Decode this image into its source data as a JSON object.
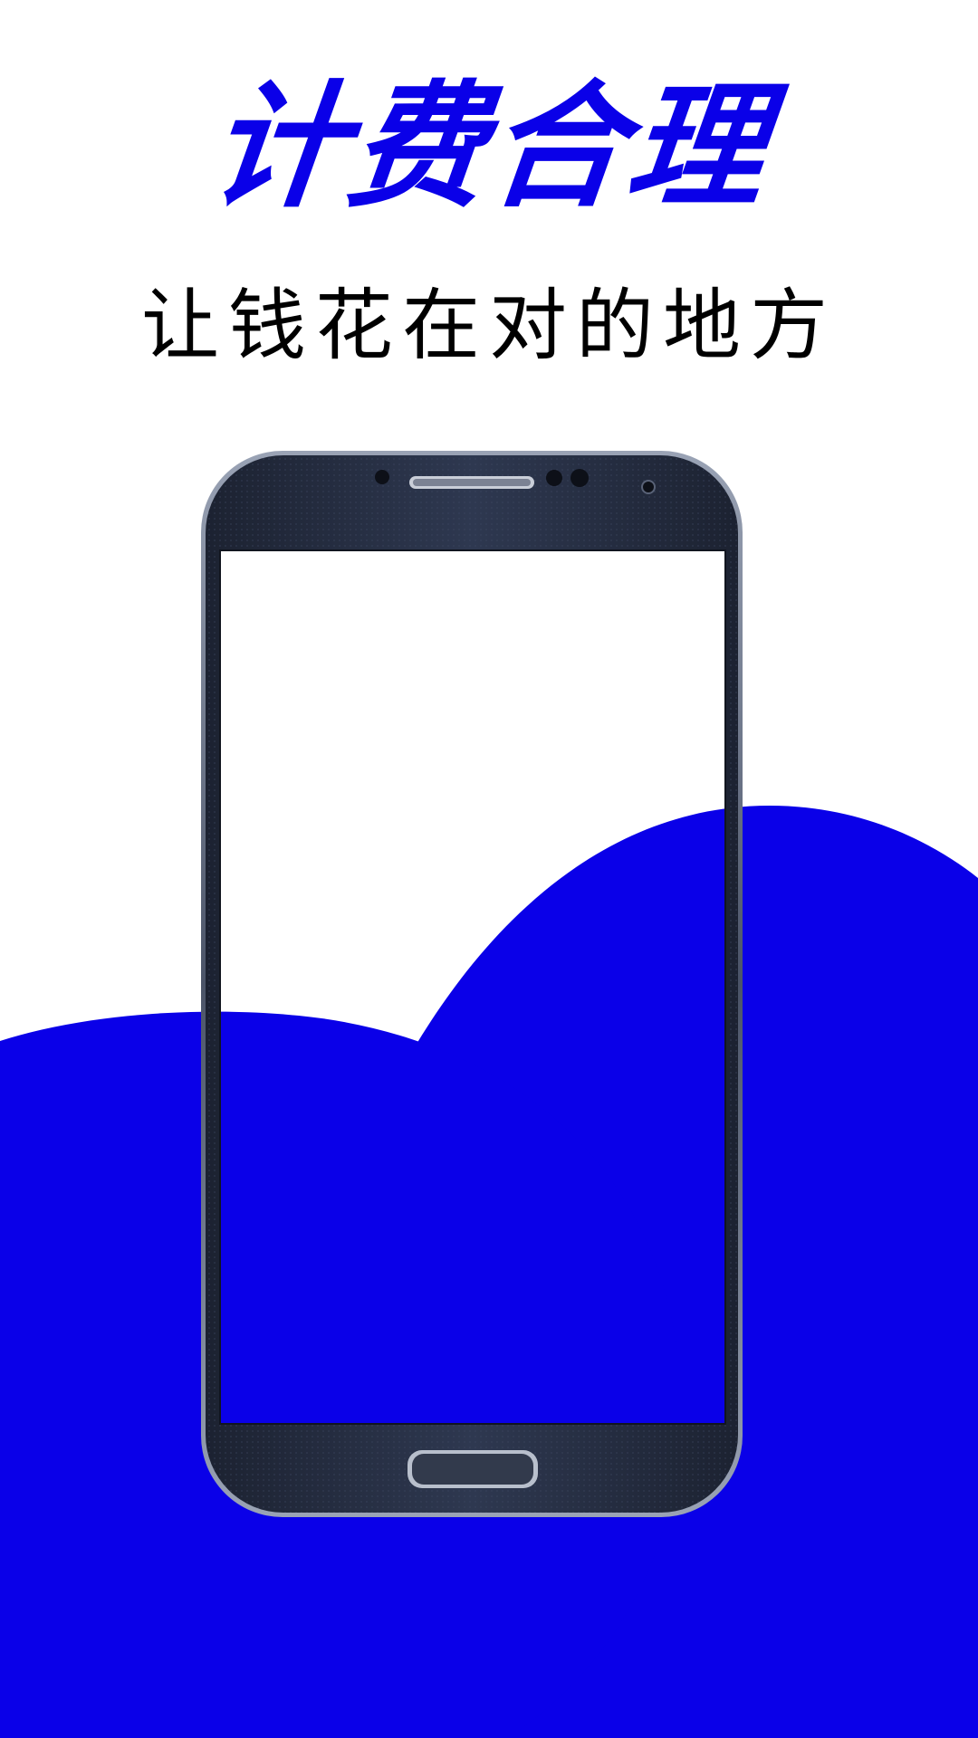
{
  "headline": "计费合理",
  "subline": "让钱花在对的地方",
  "colors": {
    "accent": "#0a00e8",
    "background": "#ffffff",
    "phone_body": "#2a3347",
    "text": "#000000"
  },
  "icons": {
    "phone_earpiece": "speaker-grille-icon",
    "phone_home_button": "home-button-icon",
    "phone_camera": "front-camera-icon"
  }
}
